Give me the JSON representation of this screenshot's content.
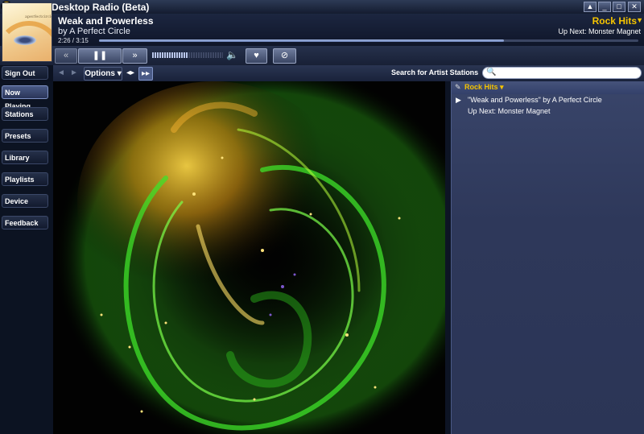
{
  "app": {
    "title": "Slacker Desktop Radio (Beta)"
  },
  "window_controls": [
    "▲",
    "_",
    "□",
    "✕"
  ],
  "now_playing": {
    "title": "Weak and Powerless",
    "artist": "by A Perfect Circle",
    "time": "2:26 / 3:15",
    "progress": 0.75,
    "album_art_text": "aperfectcircle"
  },
  "station": {
    "name": "Rock Hits",
    "arrow": "▼",
    "up_next": "Up Next: Monster Magnet"
  },
  "controls": {
    "rewind_icon": "«",
    "pause_icon": "❚❚",
    "skip_icon": "»",
    "volume_level": 0.5,
    "volume_icon": "🔈",
    "heart_icon": "♥",
    "ban_icon": "⊘"
  },
  "nav": {
    "sign_out": "Sign Out",
    "items": [
      "Now Playing",
      "Stations",
      "Presets",
      "Library",
      "Playlists",
      "Device",
      "Feedback"
    ]
  },
  "subbar": {
    "back_icon": "◄",
    "forward_icon": "►",
    "options_label": "Options ▾",
    "collapse_icon": "◂▸",
    "expand_icon": "▸▸",
    "search_label": "Search for Artist Stations",
    "search_value": "",
    "search_icon": "🔍"
  },
  "right_panel": {
    "station": "Rock Hits ▾",
    "tag_icon": "✎",
    "play_icon": "▶",
    "current": "\"Weak and Powerless\" by A Perfect Circle",
    "up_next": "Up Next: Monster Magnet"
  },
  "colors": {
    "accent_yellow": "#f5c400",
    "panel_blue": "#2e385a"
  }
}
